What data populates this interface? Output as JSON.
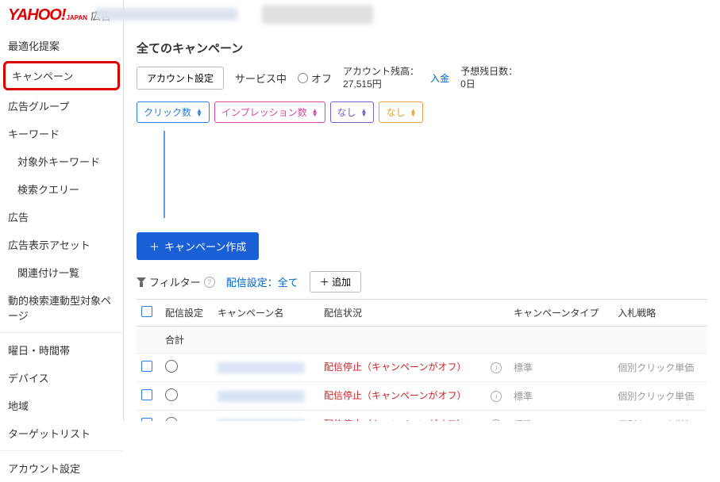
{
  "header": {
    "logo_main": "YAHOO!",
    "logo_sub": "JAPAN",
    "logo_suffix": "広告"
  },
  "sidebar": {
    "items": [
      {
        "label": "最適化提案",
        "indent": false
      },
      {
        "label": "キャンペーン",
        "indent": false,
        "active": true
      },
      {
        "label": "広告グループ",
        "indent": false
      },
      {
        "label": "キーワード",
        "indent": false
      },
      {
        "label": "対象外キーワード",
        "indent": true
      },
      {
        "label": "検索クエリー",
        "indent": true
      },
      {
        "label": "広告",
        "indent": false
      },
      {
        "label": "広告表示アセット",
        "indent": false
      },
      {
        "label": "関連付け一覧",
        "indent": true
      },
      {
        "label": "動的検索連動型対象ページ",
        "indent": false
      },
      {
        "label": "曜日・時間帯",
        "indent": false,
        "sep": true
      },
      {
        "label": "デバイス",
        "indent": false
      },
      {
        "label": "地域",
        "indent": false
      },
      {
        "label": "ターゲットリスト",
        "indent": false
      },
      {
        "label": "アカウント設定",
        "indent": false,
        "sep": true
      }
    ]
  },
  "main": {
    "title": "全てのキャンペーン",
    "account_settings_btn": "アカウント設定",
    "status_serving": "サービス中",
    "status_off": "オフ",
    "balance_label": "アカウント残高：",
    "balance_value": "27,515円",
    "deposit_link": "入金",
    "days_label": "予想残日数：",
    "days_value": "0日",
    "dropdowns": [
      {
        "label": "クリック数",
        "class": "blue"
      },
      {
        "label": "インプレッション数",
        "class": "pink"
      },
      {
        "label": "なし",
        "class": "purple"
      },
      {
        "label": "なし",
        "class": "orange"
      }
    ],
    "create_btn": "キャンペーン作成",
    "filter_label": "フィルター",
    "filter_delivery": "配信設定：全て",
    "add_btn": "追加",
    "table": {
      "headers": [
        "",
        "配信設定",
        "キャンペーン名",
        "配信状況",
        "",
        "キャンペーンタイプ",
        "入札戦略"
      ],
      "total_label": "合計",
      "rows": [
        {
          "status": "配信停止（キャンペーンがオフ）",
          "type": "標準",
          "bid": "個別クリック単価"
        },
        {
          "status": "配信停止（キャンペーンがオフ）",
          "type": "標準",
          "bid": "個別クリック単価"
        },
        {
          "status": "配信停止（キャンペーンがオフ）",
          "type": "標準",
          "bid": "個別クリック単価"
        }
      ]
    }
  }
}
